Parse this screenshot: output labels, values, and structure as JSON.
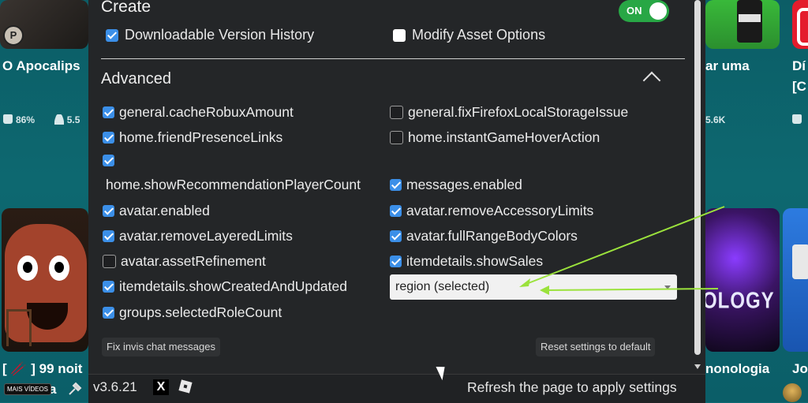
{
  "background": {
    "cards": [
      {
        "title": "O Apocalips",
        "likes": "86%",
        "players": "5.5"
      },
      {
        "title": "ar uma",
        "players": "5.6K"
      },
      {
        "title": "Dí",
        "title2": "[C"
      }
    ],
    "bottom_titles": [
      "[ 🥢 ] 99 noit",
      "a",
      "nonologia",
      "Jo"
    ],
    "thumb_text": "OLOGY",
    "mais_videos": "MAIS VÍDEOS",
    "avatar_badge": "P"
  },
  "panel": {
    "create_title": "Create",
    "toggle_label": "ON",
    "options": [
      {
        "label": "Downloadable Version History",
        "checked": true
      },
      {
        "label": "Modify Asset Options",
        "checked": false
      }
    ],
    "advanced_title": "Advanced",
    "left_items": [
      {
        "label": "general.cacheRobuxAmount",
        "checked": true
      },
      {
        "label": "home.friendPresenceLinks",
        "checked": true
      },
      {
        "label": "home.showRecommendationPlayerCount",
        "checked": true
      },
      {
        "label": "avatar.enabled",
        "checked": true
      },
      {
        "label": "avatar.removeLayeredLimits",
        "checked": true
      },
      {
        "label": "avatar.assetRefinement",
        "checked": false
      },
      {
        "label": "itemdetails.showCreatedAndUpdated",
        "checked": true
      },
      {
        "label": "groups.selectedRoleCount",
        "checked": true
      }
    ],
    "right_items": [
      {
        "label": "general.fixFirefoxLocalStorageIssue",
        "checked": false
      },
      {
        "label": "home.instantGameHoverAction",
        "checked": false
      },
      {
        "label": "messages.enabled",
        "checked": true
      },
      {
        "label": "avatar.removeAccessoryLimits",
        "checked": true
      },
      {
        "label": "avatar.fullRangeBodyColors",
        "checked": true
      },
      {
        "label": "itemdetails.showSales",
        "checked": true
      }
    ],
    "dropdown_value": "region (selected)",
    "fix_button": "Fix invis chat messages",
    "reset_button": "Reset settings to default",
    "version": "v3.6.21",
    "x_icon": "X",
    "refresh_note": "Refresh the page to apply settings"
  },
  "colors": {
    "checkbox_on": "#3b8fe8",
    "toggle_on": "#28a745",
    "annotation_arrow": "#9be23c",
    "panel_bg": "#242628"
  }
}
